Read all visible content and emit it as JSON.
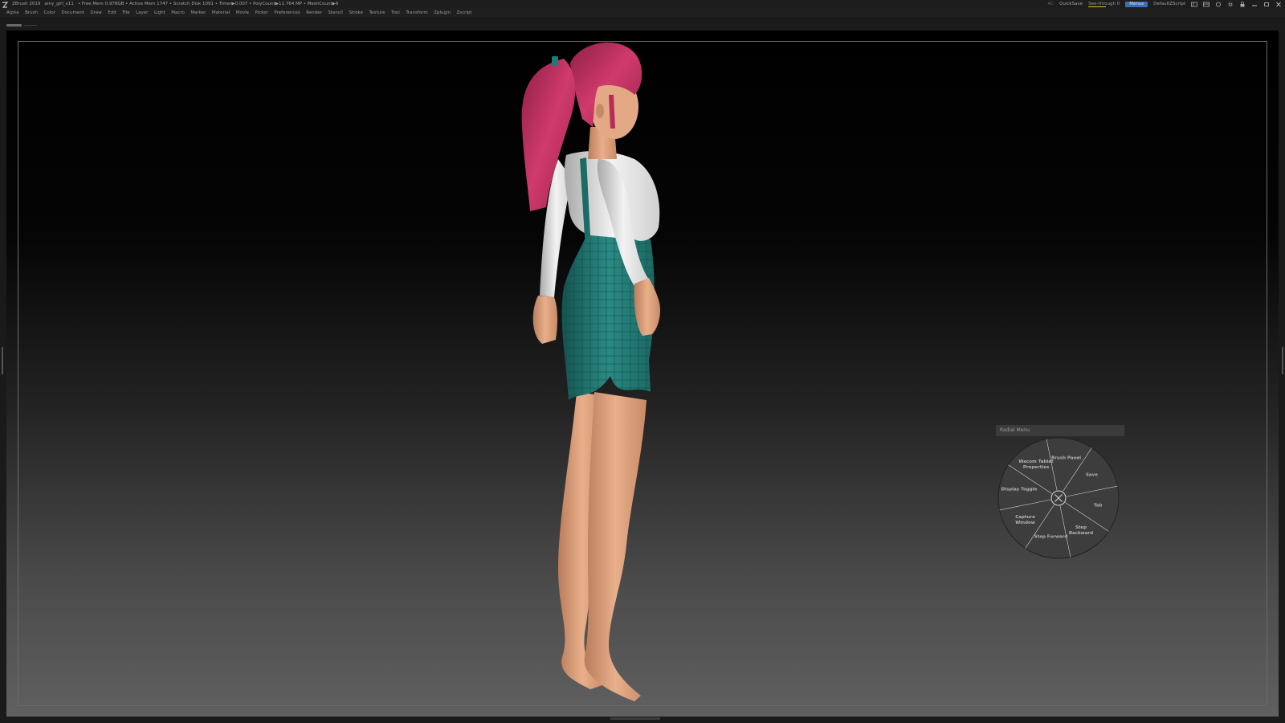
{
  "titlebar": {
    "app_title": "ZBrush 2019",
    "document": "amy_girl_v11",
    "stats": "• Free Mem 0.978GB • Active Mem 1747 • Scratch Disk 1091 • Timer▶0.007 • PolyCount▶11.764 MP • MeshCount▶9",
    "ac": "AC",
    "quicksave": "QuickSave",
    "see_through": "See-through   0",
    "menus": "Menus",
    "default_script": "DefaultZScript",
    "accent_color": "#e6b836",
    "menus_color": "#3a6fb8"
  },
  "menubar": {
    "items": [
      "Alpha",
      "Brush",
      "Color",
      "Document",
      "Draw",
      "Edit",
      "File",
      "Layer",
      "Light",
      "Macro",
      "Marker",
      "Material",
      "Movie",
      "Picker",
      "Preferences",
      "Render",
      "Stencil",
      "Stroke",
      "Texture",
      "Tool",
      "Transform",
      "Zplugin",
      "Zscript"
    ]
  },
  "radial": {
    "title": "Radial Menu",
    "segments": [
      {
        "label": "Brush Panel"
      },
      {
        "label": "Save"
      },
      {
        "label": "Tab"
      },
      {
        "label": "Step Backward"
      },
      {
        "label": "Step Forward"
      },
      {
        "label": "Capture Window"
      },
      {
        "label": "Display Toggle"
      },
      {
        "label": "Wacom Tablet Properties"
      }
    ],
    "icons": [
      "pin-icon",
      "wrench-icon",
      "close-icon"
    ]
  }
}
